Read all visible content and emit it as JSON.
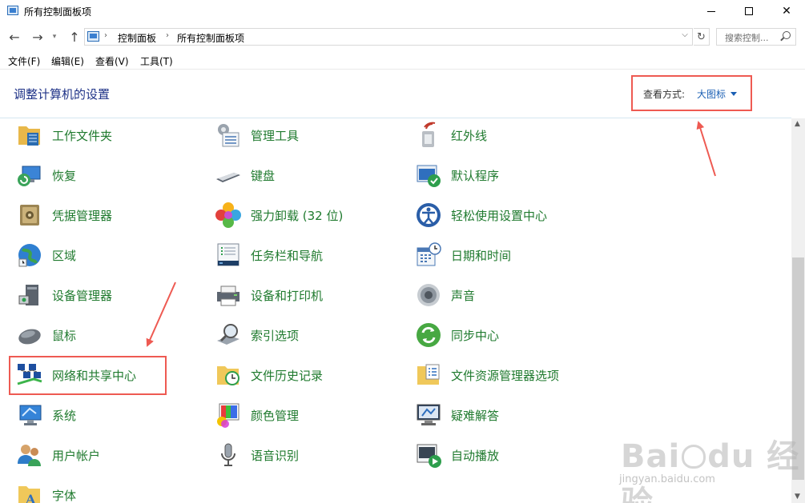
{
  "window": {
    "title": "所有控制面板项"
  },
  "address": {
    "crumbs": [
      "控制面板",
      "所有控制面板项"
    ],
    "search_placeholder": "搜索控制..."
  },
  "menu": [
    "文件(F)",
    "编辑(E)",
    "查看(V)",
    "工具(T)"
  ],
  "header": {
    "title": "调整计算机的设置",
    "view_by_label": "查看方式:",
    "view_by_value": "大图标"
  },
  "items": [
    {
      "label": "工作文件夹",
      "icon": "work-folders-icon"
    },
    {
      "label": "管理工具",
      "icon": "admin-tools-icon"
    },
    {
      "label": "红外线",
      "icon": "infrared-icon"
    },
    {
      "label": "恢复",
      "icon": "recovery-icon"
    },
    {
      "label": "键盘",
      "icon": "keyboard-icon"
    },
    {
      "label": "默认程序",
      "icon": "default-programs-icon"
    },
    {
      "label": "凭据管理器",
      "icon": "credential-manager-icon"
    },
    {
      "label": "强力卸载 (32 位)",
      "icon": "uninstaller-icon"
    },
    {
      "label": "轻松使用设置中心",
      "icon": "ease-of-access-icon"
    },
    {
      "label": "区域",
      "icon": "region-globe-icon"
    },
    {
      "label": "任务栏和导航",
      "icon": "taskbar-icon"
    },
    {
      "label": "日期和时间",
      "icon": "date-time-icon"
    },
    {
      "label": "设备管理器",
      "icon": "device-manager-icon"
    },
    {
      "label": "设备和打印机",
      "icon": "printer-icon"
    },
    {
      "label": "声音",
      "icon": "sound-speaker-icon"
    },
    {
      "label": "鼠标",
      "icon": "mouse-icon"
    },
    {
      "label": "索引选项",
      "icon": "indexing-icon"
    },
    {
      "label": "同步中心",
      "icon": "sync-center-icon"
    },
    {
      "label": "网络和共享中心",
      "icon": "network-icon"
    },
    {
      "label": "文件历史记录",
      "icon": "file-history-icon"
    },
    {
      "label": "文件资源管理器选项",
      "icon": "folder-options-icon"
    },
    {
      "label": "系统",
      "icon": "system-monitor-icon"
    },
    {
      "label": "颜色管理",
      "icon": "color-management-icon"
    },
    {
      "label": "疑难解答",
      "icon": "troubleshooting-icon"
    },
    {
      "label": "用户帐户",
      "icon": "user-accounts-icon"
    },
    {
      "label": "语音识别",
      "icon": "microphone-icon"
    },
    {
      "label": "自动播放",
      "icon": "autoplay-icon"
    },
    {
      "label": "字体",
      "icon": "fonts-icon"
    }
  ],
  "watermark": {
    "text": "Bai  经验",
    "sub": "jingyan.baidu.com"
  },
  "colors": {
    "item_label": "#1f7a2e",
    "heading": "#1e3287",
    "link": "#1a5fb4",
    "annotation": "#ee5a52"
  }
}
